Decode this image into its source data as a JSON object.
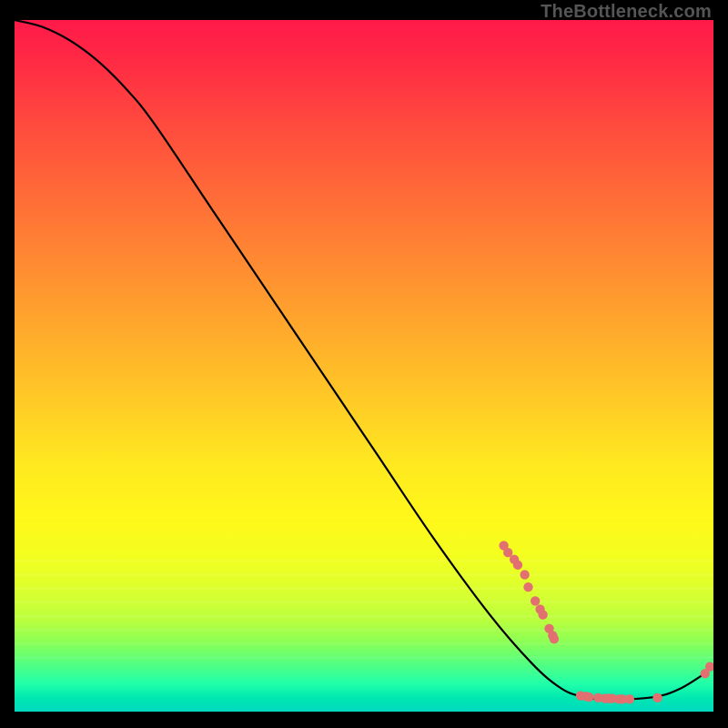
{
  "watermark": "TheBottleneck.com",
  "chart_data": {
    "type": "line",
    "title": "",
    "xlabel": "",
    "ylabel": "",
    "xlim": [
      0,
      100
    ],
    "ylim": [
      0,
      100
    ],
    "background": "rainbow-gradient-vertical",
    "curve": [
      {
        "x": 0,
        "y": 100
      },
      {
        "x": 4,
        "y": 99
      },
      {
        "x": 8,
        "y": 97
      },
      {
        "x": 12,
        "y": 94
      },
      {
        "x": 16,
        "y": 90
      },
      {
        "x": 20,
        "y": 85
      },
      {
        "x": 28,
        "y": 73
      },
      {
        "x": 36,
        "y": 61
      },
      {
        "x": 44,
        "y": 49
      },
      {
        "x": 52,
        "y": 37
      },
      {
        "x": 60,
        "y": 25
      },
      {
        "x": 68,
        "y": 14
      },
      {
        "x": 74,
        "y": 7
      },
      {
        "x": 78,
        "y": 3.5
      },
      {
        "x": 81,
        "y": 2.2
      },
      {
        "x": 84,
        "y": 1.8
      },
      {
        "x": 88,
        "y": 1.8
      },
      {
        "x": 92,
        "y": 2.2
      },
      {
        "x": 95,
        "y": 3.2
      },
      {
        "x": 98,
        "y": 5.0
      },
      {
        "x": 100,
        "y": 6.5
      }
    ],
    "markers": [
      {
        "x": 70.0,
        "y": 24.0
      },
      {
        "x": 70.6,
        "y": 23.0
      },
      {
        "x": 71.5,
        "y": 22.0
      },
      {
        "x": 72.0,
        "y": 21.2
      },
      {
        "x": 73.0,
        "y": 19.8
      },
      {
        "x": 73.5,
        "y": 18.0
      },
      {
        "x": 74.5,
        "y": 16.0
      },
      {
        "x": 75.2,
        "y": 14.8
      },
      {
        "x": 75.6,
        "y": 14.0
      },
      {
        "x": 76.5,
        "y": 12.0
      },
      {
        "x": 77.0,
        "y": 11.0
      },
      {
        "x": 77.2,
        "y": 10.5
      },
      {
        "x": 81.0,
        "y": 2.3
      },
      {
        "x": 81.8,
        "y": 2.2
      },
      {
        "x": 82.2,
        "y": 2.1
      },
      {
        "x": 83.5,
        "y": 2.0
      },
      {
        "x": 84.5,
        "y": 1.9
      },
      {
        "x": 85.0,
        "y": 1.9
      },
      {
        "x": 85.5,
        "y": 1.9
      },
      {
        "x": 86.5,
        "y": 1.8
      },
      {
        "x": 87.0,
        "y": 1.8
      },
      {
        "x": 88.0,
        "y": 1.8
      },
      {
        "x": 92.0,
        "y": 2.0
      },
      {
        "x": 98.8,
        "y": 5.5
      },
      {
        "x": 99.5,
        "y": 6.5
      }
    ],
    "marker_color": "#e27070"
  }
}
